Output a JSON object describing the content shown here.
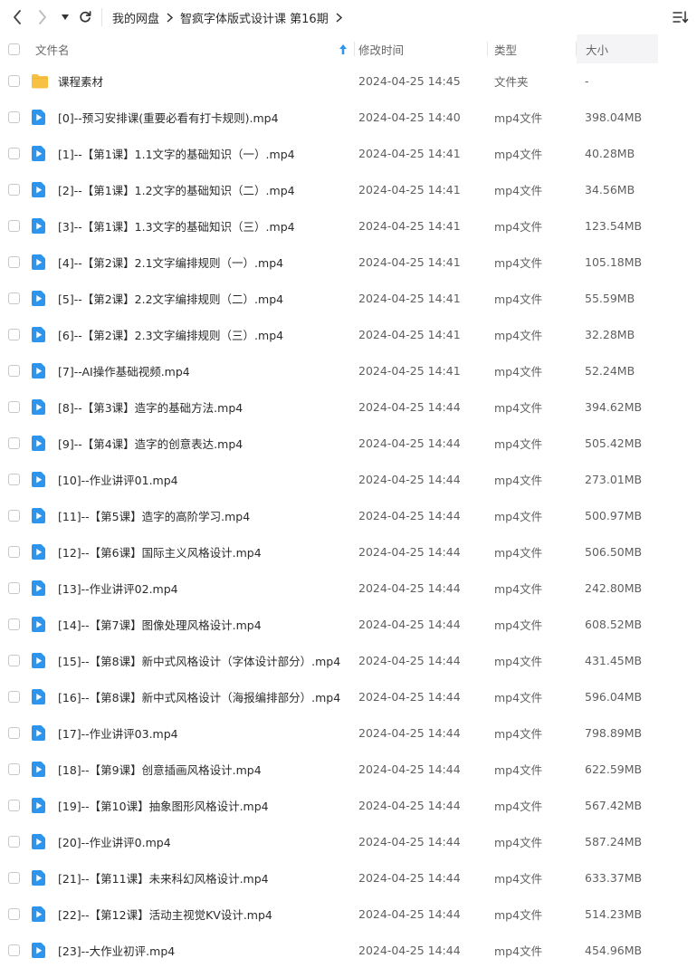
{
  "toolbar": {
    "back_icon": "chevron-left-icon",
    "forward_icon": "chevron-right-icon",
    "history_icon": "caret-down-icon",
    "refresh_icon": "refresh-icon",
    "sort_view_icon": "sort-list-icon",
    "breadcrumb": [
      "我的网盘",
      "智疯字体版式设计课 第16期"
    ]
  },
  "table": {
    "columns": {
      "name": "文件名",
      "date": "修改时间",
      "type": "类型",
      "size": "大小"
    },
    "sort_icon": "sort-up-arrow-icon",
    "accent_color": "#2d95ee",
    "folder_color": "#f7c243",
    "rows": [
      {
        "name": "课程素材",
        "date": "2024-04-25 14:45",
        "type": "文件夹",
        "size": "-",
        "icon": "folder-icon"
      },
      {
        "name": "[0]--预习安排课(重要必看有打卡规则).mp4",
        "date": "2024-04-25 14:40",
        "type": "mp4文件",
        "size": "398.04MB",
        "icon": "video-file-icon"
      },
      {
        "name": "[1]--【第1课】1.1文字的基础知识（一）.mp4",
        "date": "2024-04-25 14:41",
        "type": "mp4文件",
        "size": "40.28MB",
        "icon": "video-file-icon"
      },
      {
        "name": "[2]--【第1课】1.2文字的基础知识（二）.mp4",
        "date": "2024-04-25 14:41",
        "type": "mp4文件",
        "size": "34.56MB",
        "icon": "video-file-icon"
      },
      {
        "name": "[3]--【第1课】1.3文字的基础知识（三）.mp4",
        "date": "2024-04-25 14:41",
        "type": "mp4文件",
        "size": "123.54MB",
        "icon": "video-file-icon"
      },
      {
        "name": "[4]--【第2课】2.1文字编排规则（一）.mp4",
        "date": "2024-04-25 14:41",
        "type": "mp4文件",
        "size": "105.18MB",
        "icon": "video-file-icon"
      },
      {
        "name": "[5]--【第2课】2.2文字编排规则（二）.mp4",
        "date": "2024-04-25 14:41",
        "type": "mp4文件",
        "size": "55.59MB",
        "icon": "video-file-icon"
      },
      {
        "name": "[6]--【第2课】2.3文字编排规则（三）.mp4",
        "date": "2024-04-25 14:41",
        "type": "mp4文件",
        "size": "32.28MB",
        "icon": "video-file-icon"
      },
      {
        "name": "[7]--AI操作基础视频.mp4",
        "date": "2024-04-25 14:41",
        "type": "mp4文件",
        "size": "52.24MB",
        "icon": "video-file-icon"
      },
      {
        "name": "[8]--【第3课】造字的基础方法.mp4",
        "date": "2024-04-25 14:44",
        "type": "mp4文件",
        "size": "394.62MB",
        "icon": "video-file-icon"
      },
      {
        "name": "[9]--【第4课】造字的创意表达.mp4",
        "date": "2024-04-25 14:44",
        "type": "mp4文件",
        "size": "505.42MB",
        "icon": "video-file-icon"
      },
      {
        "name": "[10]--作业讲评01.mp4",
        "date": "2024-04-25 14:44",
        "type": "mp4文件",
        "size": "273.01MB",
        "icon": "video-file-icon"
      },
      {
        "name": "[11]--【第5课】造字的高阶学习.mp4",
        "date": "2024-04-25 14:44",
        "type": "mp4文件",
        "size": "500.97MB",
        "icon": "video-file-icon"
      },
      {
        "name": "[12]--【第6课】国际主义风格设计.mp4",
        "date": "2024-04-25 14:44",
        "type": "mp4文件",
        "size": "506.50MB",
        "icon": "video-file-icon"
      },
      {
        "name": "[13]--作业讲评02.mp4",
        "date": "2024-04-25 14:44",
        "type": "mp4文件",
        "size": "242.80MB",
        "icon": "video-file-icon"
      },
      {
        "name": "[14]--【第7课】图像处理风格设计.mp4",
        "date": "2024-04-25 14:44",
        "type": "mp4文件",
        "size": "608.52MB",
        "icon": "video-file-icon"
      },
      {
        "name": "[15]--【第8课】新中式风格设计（字体设计部分）.mp4",
        "date": "2024-04-25 14:44",
        "type": "mp4文件",
        "size": "431.45MB",
        "icon": "video-file-icon"
      },
      {
        "name": "[16]--【第8课】新中式风格设计（海报编排部分）.mp4",
        "date": "2024-04-25 14:44",
        "type": "mp4文件",
        "size": "596.04MB",
        "icon": "video-file-icon"
      },
      {
        "name": "[17]--作业讲评03.mp4",
        "date": "2024-04-25 14:44",
        "type": "mp4文件",
        "size": "798.89MB",
        "icon": "video-file-icon"
      },
      {
        "name": "[18]--【第9课】创意插画风格设计.mp4",
        "date": "2024-04-25 14:44",
        "type": "mp4文件",
        "size": "622.59MB",
        "icon": "video-file-icon"
      },
      {
        "name": "[19]--【第10课】抽象图形风格设计.mp4",
        "date": "2024-04-25 14:44",
        "type": "mp4文件",
        "size": "567.42MB",
        "icon": "video-file-icon"
      },
      {
        "name": "[20]--作业讲评0.mp4",
        "date": "2024-04-25 14:44",
        "type": "mp4文件",
        "size": "587.24MB",
        "icon": "video-file-icon"
      },
      {
        "name": "[21]--【第11课】未来科幻风格设计.mp4",
        "date": "2024-04-25 14:44",
        "type": "mp4文件",
        "size": "633.37MB",
        "icon": "video-file-icon"
      },
      {
        "name": "[22]--【第12课】活动主视觉KV设计.mp4",
        "date": "2024-04-25 14:44",
        "type": "mp4文件",
        "size": "514.23MB",
        "icon": "video-file-icon"
      },
      {
        "name": "[23]--大作业初评.mp4",
        "date": "2024-04-25 14:44",
        "type": "mp4文件",
        "size": "454.96MB",
        "icon": "video-file-icon"
      }
    ]
  }
}
